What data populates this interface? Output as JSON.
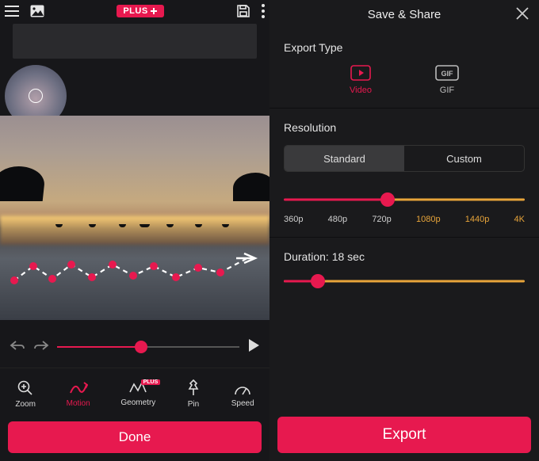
{
  "left": {
    "plus_badge": "PLUS",
    "tools": {
      "zoom": "Zoom",
      "motion": "Motion",
      "geometry": "Geometry",
      "geometry_badge": "PLUS",
      "pin": "Pin",
      "speed": "Speed"
    },
    "done": "Done",
    "timeline_pct": 46
  },
  "right": {
    "title": "Save & Share",
    "export_type_title": "Export Type",
    "types": {
      "video": "Video",
      "gif": "GIF"
    },
    "resolution_title": "Resolution",
    "segments": {
      "standard": "Standard",
      "custom": "Custom"
    },
    "res_labels": [
      "360p",
      "480p",
      "720p",
      "1080p",
      "1440p",
      "4K"
    ],
    "selected_res_index": 2,
    "duration_title": "Duration: 18 sec",
    "export": "Export"
  }
}
